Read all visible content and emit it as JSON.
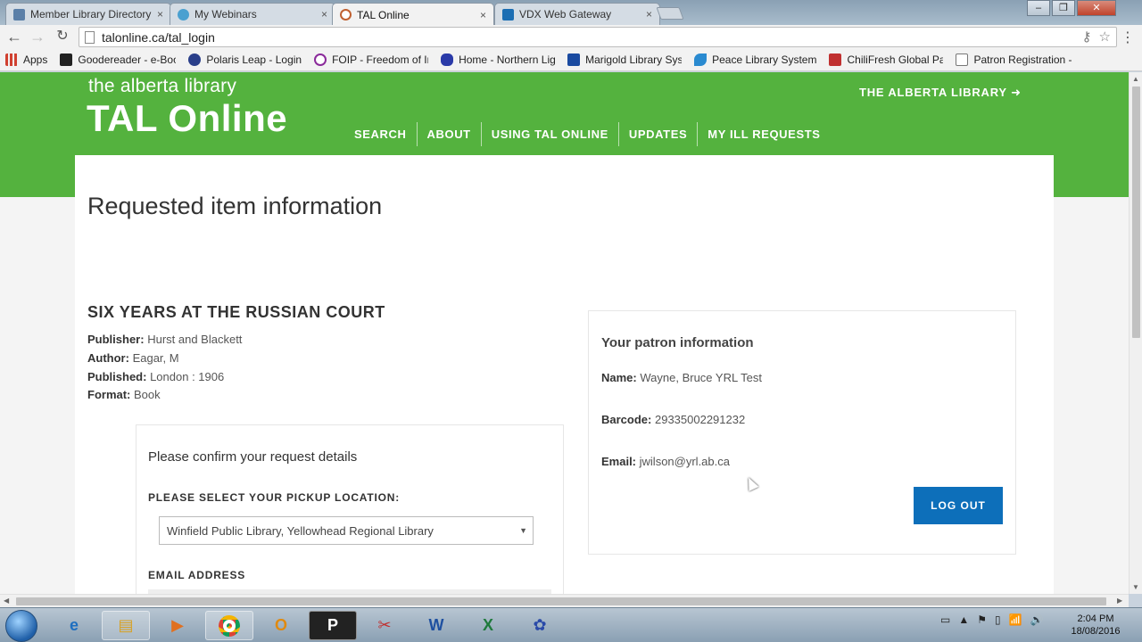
{
  "browser": {
    "tabs": [
      {
        "label": "Member Library Directory",
        "icon": "library-directory-icon",
        "color": "#5a7fa8"
      },
      {
        "label": "My Webinars",
        "icon": "webinars-icon",
        "color": "#4aa0d0"
      },
      {
        "label": "TAL Online",
        "icon": "tal-online-icon",
        "color": "#c06030"
      },
      {
        "label": "VDX Web Gateway",
        "icon": "vdx-icon",
        "color": "#1b6eb3"
      }
    ],
    "tab_close": "×",
    "url": "talonline.ca/tal_login",
    "bookmarks": [
      {
        "label": "Apps",
        "color": "#d04030"
      },
      {
        "label": "Goodereader - e-Boo",
        "color": "#222222"
      },
      {
        "label": "Polaris Leap - Login",
        "color": "#2a3f8a"
      },
      {
        "label": "FOIP - Freedom of Inf",
        "color": "#8a2a9a"
      },
      {
        "label": "Home - Northern Ligh",
        "color": "#2a3aa8"
      },
      {
        "label": "Marigold Library Syst",
        "color": "#1a4aa0"
      },
      {
        "label": "Peace Library System",
        "color": "#2a8ad0"
      },
      {
        "label": "ChiliFresh Global Patr",
        "color": "#c03030"
      },
      {
        "label": "Patron Registration -",
        "color": "#777777"
      }
    ]
  },
  "site": {
    "logo_small": "the alberta library",
    "logo_big": "TAL Online",
    "tal_link": "THE ALBERTA LIBRARY",
    "nav": [
      "SEARCH",
      "ABOUT",
      "USING TAL ONLINE",
      "UPDATES",
      "MY ILL REQUESTS"
    ],
    "brand_color": "#54b23e"
  },
  "page": {
    "title": "Requested item information",
    "book": {
      "title": "SIX YEARS AT THE RUSSIAN COURT",
      "publisher_label": "Publisher:",
      "publisher": "Hurst and Blackett",
      "author_label": "Author:",
      "author": "Eagar, M",
      "published_label": "Published:",
      "published": "London : 1906",
      "format_label": "Format:",
      "format": "Book"
    },
    "confirm": {
      "heading": "Please confirm your request details",
      "pickup_label": "PLEASE SELECT YOUR PICKUP LOCATION:",
      "pickup_value": "Winfield Public Library, Yellowhead Regional Library",
      "email_label": "EMAIL ADDRESS"
    },
    "patron": {
      "heading": "Your patron information",
      "name_label": "Name:",
      "name": "Wayne, Bruce YRL Test",
      "barcode_label": "Barcode:",
      "barcode": "29335002291232",
      "email_label": "Email:",
      "email": "jwilson@yrl.ab.ca",
      "logout": "LOG OUT"
    },
    "button_color": "#0d6fba"
  },
  "taskbar": {
    "clock_time": "2:04 PM",
    "clock_date": "18/08/2016"
  }
}
